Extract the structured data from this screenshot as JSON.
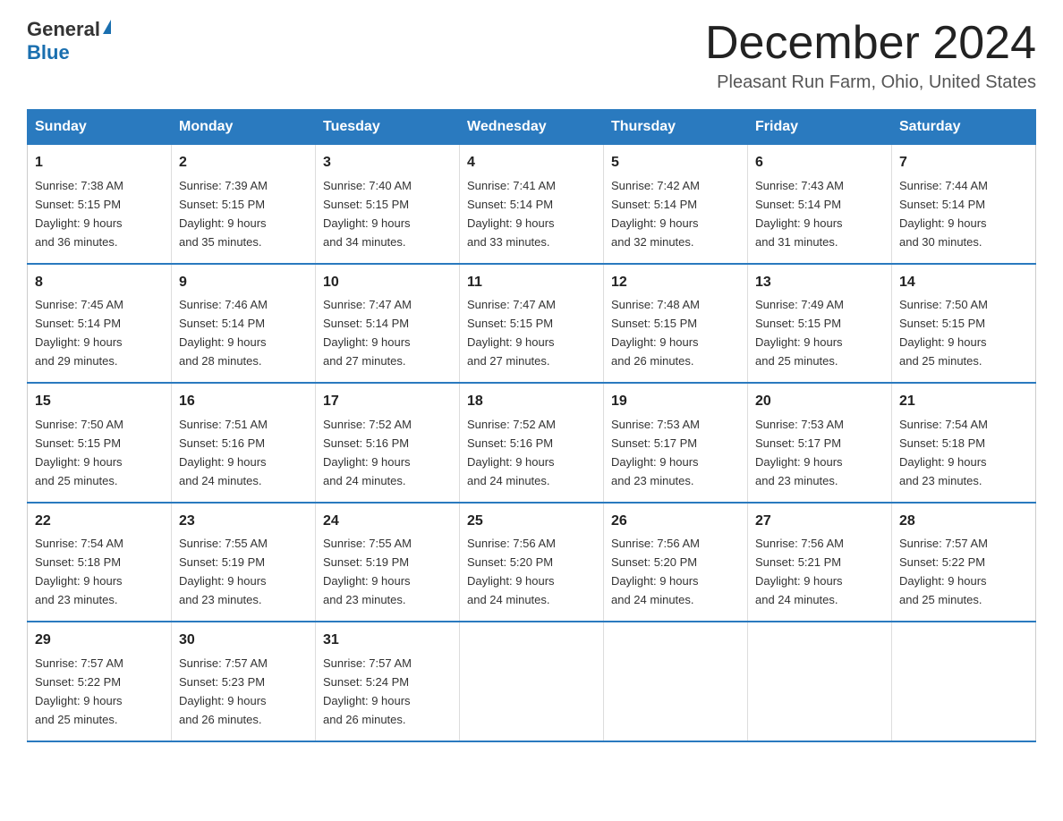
{
  "logo": {
    "general": "General",
    "triangle": "▲",
    "blue": "Blue"
  },
  "title": {
    "month_year": "December 2024",
    "location": "Pleasant Run Farm, Ohio, United States"
  },
  "days_of_week": [
    "Sunday",
    "Monday",
    "Tuesday",
    "Wednesday",
    "Thursday",
    "Friday",
    "Saturday"
  ],
  "weeks": [
    [
      {
        "num": "1",
        "sunrise": "7:38 AM",
        "sunset": "5:15 PM",
        "daylight": "9 hours and 36 minutes."
      },
      {
        "num": "2",
        "sunrise": "7:39 AM",
        "sunset": "5:15 PM",
        "daylight": "9 hours and 35 minutes."
      },
      {
        "num": "3",
        "sunrise": "7:40 AM",
        "sunset": "5:15 PM",
        "daylight": "9 hours and 34 minutes."
      },
      {
        "num": "4",
        "sunrise": "7:41 AM",
        "sunset": "5:14 PM",
        "daylight": "9 hours and 33 minutes."
      },
      {
        "num": "5",
        "sunrise": "7:42 AM",
        "sunset": "5:14 PM",
        "daylight": "9 hours and 32 minutes."
      },
      {
        "num": "6",
        "sunrise": "7:43 AM",
        "sunset": "5:14 PM",
        "daylight": "9 hours and 31 minutes."
      },
      {
        "num": "7",
        "sunrise": "7:44 AM",
        "sunset": "5:14 PM",
        "daylight": "9 hours and 30 minutes."
      }
    ],
    [
      {
        "num": "8",
        "sunrise": "7:45 AM",
        "sunset": "5:14 PM",
        "daylight": "9 hours and 29 minutes."
      },
      {
        "num": "9",
        "sunrise": "7:46 AM",
        "sunset": "5:14 PM",
        "daylight": "9 hours and 28 minutes."
      },
      {
        "num": "10",
        "sunrise": "7:47 AM",
        "sunset": "5:14 PM",
        "daylight": "9 hours and 27 minutes."
      },
      {
        "num": "11",
        "sunrise": "7:47 AM",
        "sunset": "5:15 PM",
        "daylight": "9 hours and 27 minutes."
      },
      {
        "num": "12",
        "sunrise": "7:48 AM",
        "sunset": "5:15 PM",
        "daylight": "9 hours and 26 minutes."
      },
      {
        "num": "13",
        "sunrise": "7:49 AM",
        "sunset": "5:15 PM",
        "daylight": "9 hours and 25 minutes."
      },
      {
        "num": "14",
        "sunrise": "7:50 AM",
        "sunset": "5:15 PM",
        "daylight": "9 hours and 25 minutes."
      }
    ],
    [
      {
        "num": "15",
        "sunrise": "7:50 AM",
        "sunset": "5:15 PM",
        "daylight": "9 hours and 25 minutes."
      },
      {
        "num": "16",
        "sunrise": "7:51 AM",
        "sunset": "5:16 PM",
        "daylight": "9 hours and 24 minutes."
      },
      {
        "num": "17",
        "sunrise": "7:52 AM",
        "sunset": "5:16 PM",
        "daylight": "9 hours and 24 minutes."
      },
      {
        "num": "18",
        "sunrise": "7:52 AM",
        "sunset": "5:16 PM",
        "daylight": "9 hours and 24 minutes."
      },
      {
        "num": "19",
        "sunrise": "7:53 AM",
        "sunset": "5:17 PM",
        "daylight": "9 hours and 23 minutes."
      },
      {
        "num": "20",
        "sunrise": "7:53 AM",
        "sunset": "5:17 PM",
        "daylight": "9 hours and 23 minutes."
      },
      {
        "num": "21",
        "sunrise": "7:54 AM",
        "sunset": "5:18 PM",
        "daylight": "9 hours and 23 minutes."
      }
    ],
    [
      {
        "num": "22",
        "sunrise": "7:54 AM",
        "sunset": "5:18 PM",
        "daylight": "9 hours and 23 minutes."
      },
      {
        "num": "23",
        "sunrise": "7:55 AM",
        "sunset": "5:19 PM",
        "daylight": "9 hours and 23 minutes."
      },
      {
        "num": "24",
        "sunrise": "7:55 AM",
        "sunset": "5:19 PM",
        "daylight": "9 hours and 23 minutes."
      },
      {
        "num": "25",
        "sunrise": "7:56 AM",
        "sunset": "5:20 PM",
        "daylight": "9 hours and 24 minutes."
      },
      {
        "num": "26",
        "sunrise": "7:56 AM",
        "sunset": "5:20 PM",
        "daylight": "9 hours and 24 minutes."
      },
      {
        "num": "27",
        "sunrise": "7:56 AM",
        "sunset": "5:21 PM",
        "daylight": "9 hours and 24 minutes."
      },
      {
        "num": "28",
        "sunrise": "7:57 AM",
        "sunset": "5:22 PM",
        "daylight": "9 hours and 25 minutes."
      }
    ],
    [
      {
        "num": "29",
        "sunrise": "7:57 AM",
        "sunset": "5:22 PM",
        "daylight": "9 hours and 25 minutes."
      },
      {
        "num": "30",
        "sunrise": "7:57 AM",
        "sunset": "5:23 PM",
        "daylight": "9 hours and 26 minutes."
      },
      {
        "num": "31",
        "sunrise": "7:57 AM",
        "sunset": "5:24 PM",
        "daylight": "9 hours and 26 minutes."
      },
      null,
      null,
      null,
      null
    ]
  ],
  "labels": {
    "sunrise": "Sunrise:",
    "sunset": "Sunset:",
    "daylight": "Daylight:"
  }
}
